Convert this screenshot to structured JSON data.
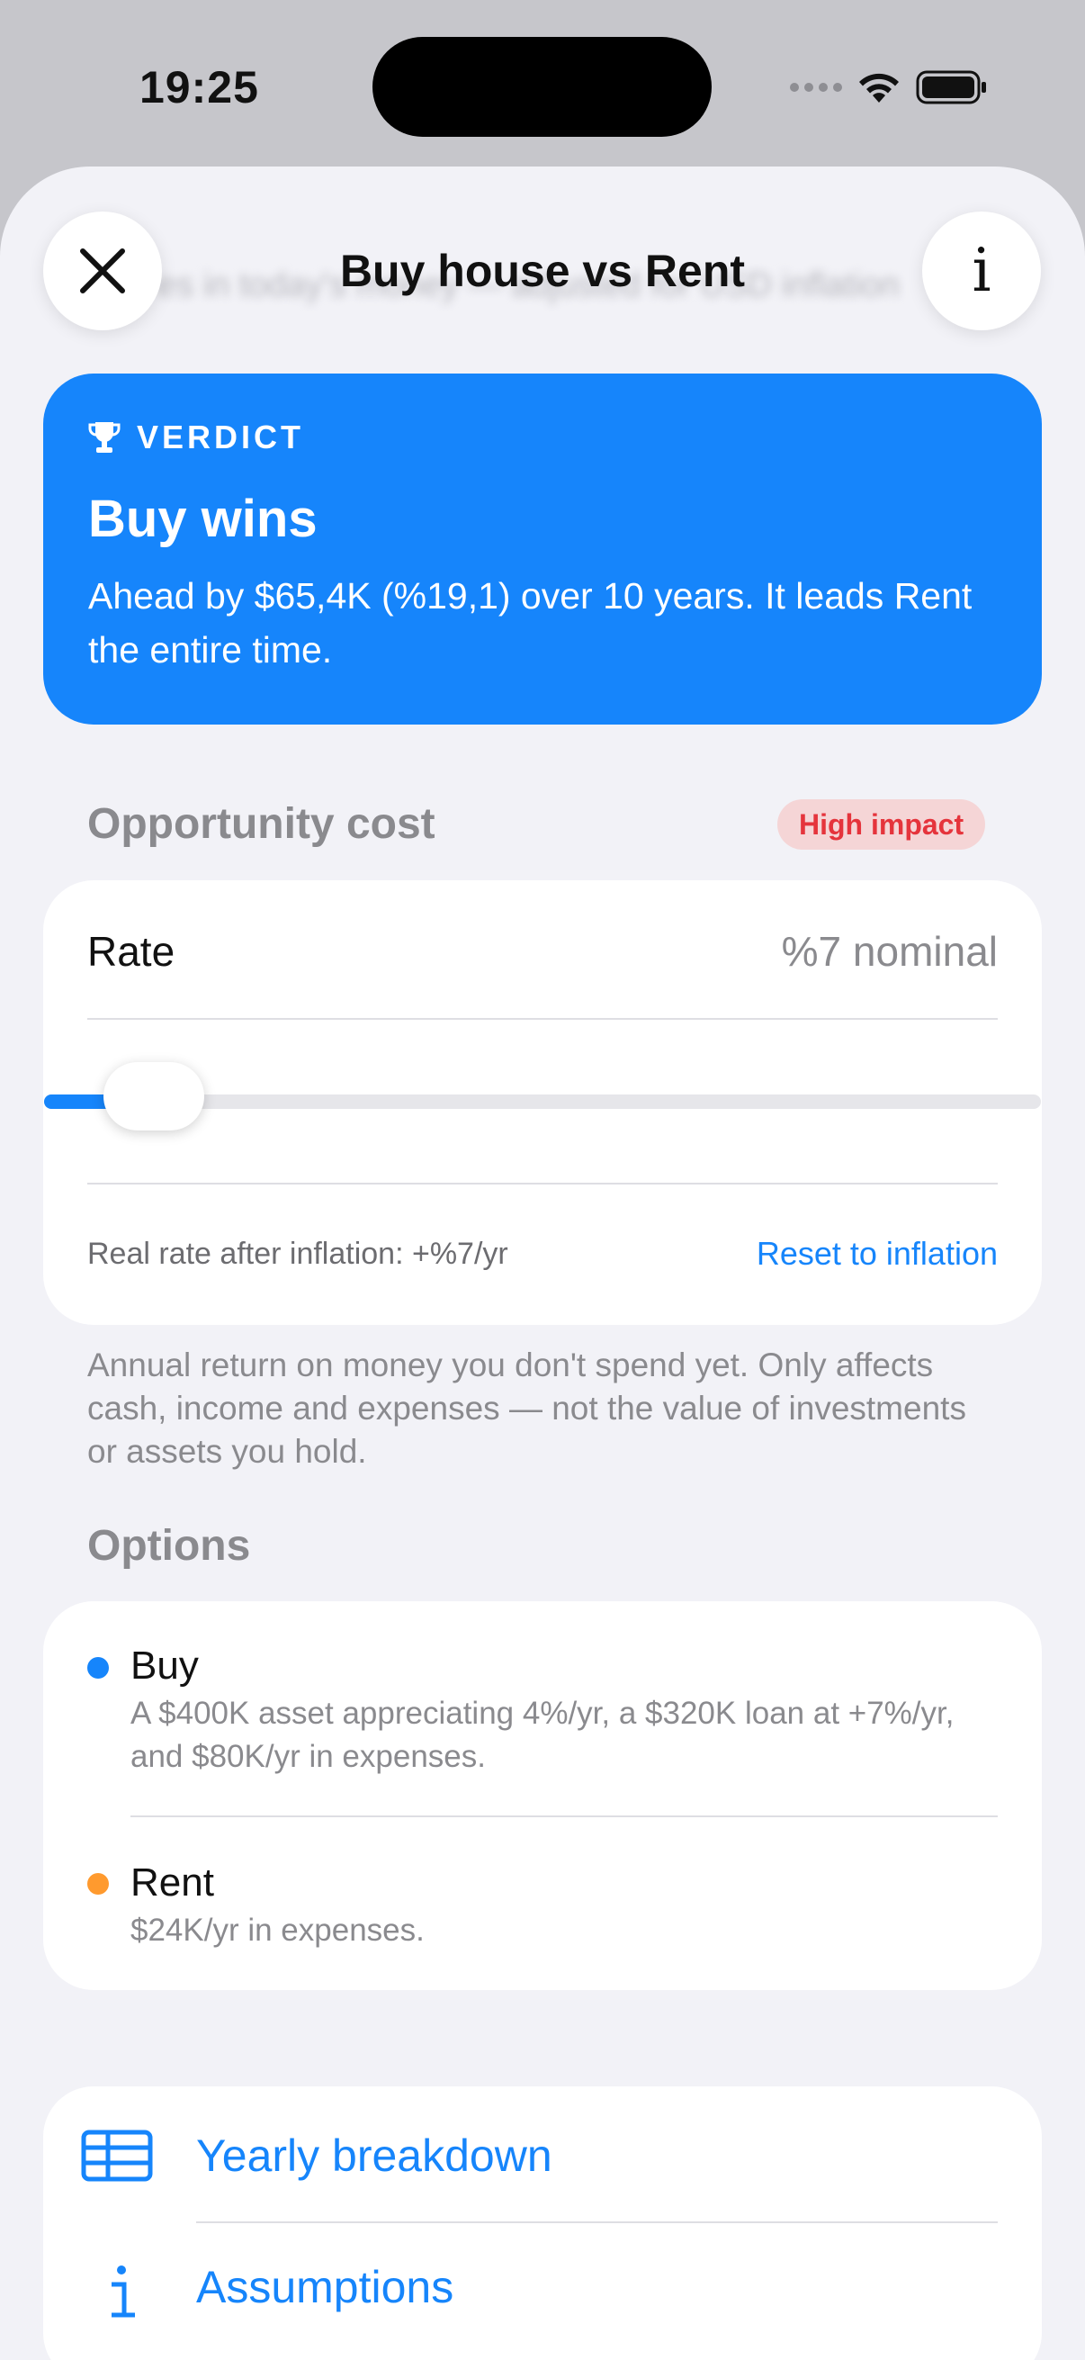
{
  "status_bar": {
    "time": "19:25"
  },
  "background": {
    "ghost_text": "es in today's money — adjusted for USD inflation"
  },
  "header": {
    "title": "Buy house vs Rent"
  },
  "verdict": {
    "label": "VERDICT",
    "title": "Buy wins",
    "description": "Ahead by $65,4K (%19,1) over 10 years. It leads Rent the entire time."
  },
  "opportunity_cost": {
    "heading": "Opportunity cost",
    "badge": "High impact",
    "rate_label": "Rate",
    "rate_value": "%7 nominal",
    "slider_fraction": 0.06,
    "real_rate": "Real rate after inflation: +%7/yr",
    "reset_label": "Reset to inflation",
    "footnote": "Annual return on money you don't spend yet. Only affects cash, income and expenses — not the value of investments or assets you hold."
  },
  "options": {
    "heading": "Options",
    "items": [
      {
        "name": "Buy",
        "color": "#1685fb",
        "description": "A $400K asset appreciating 4%/yr, a $320K loan at +7%/yr, and $80K/yr in expenses."
      },
      {
        "name": "Rent",
        "color": "#ff9a2e",
        "description": "$24K/yr in expenses."
      }
    ]
  },
  "links": [
    {
      "label": "Yearly breakdown",
      "icon": "table-icon"
    },
    {
      "label": "Assumptions",
      "icon": "info-icon"
    }
  ],
  "colors": {
    "accent": "#1685fb",
    "badge_text": "#e5343c",
    "badge_bg": "#f5d5d6"
  }
}
